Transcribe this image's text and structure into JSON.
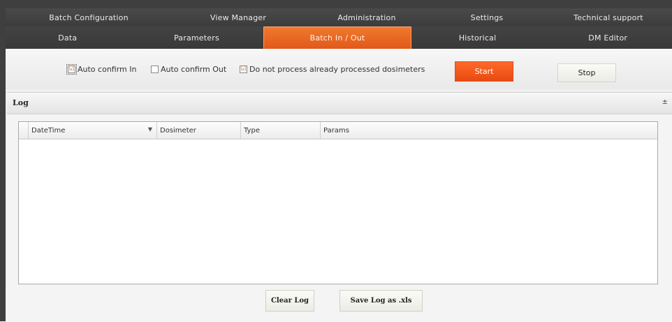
{
  "nav": {
    "top_tabs": [
      {
        "label": "Batch Configuration"
      },
      {
        "label": "View Manager"
      },
      {
        "label": "Administration"
      },
      {
        "label": "Settings"
      },
      {
        "label": "Technical support"
      }
    ],
    "bottom_tabs": [
      {
        "label": "Data"
      },
      {
        "label": "Parameters"
      },
      {
        "label": "Batch In / Out",
        "active": true
      },
      {
        "label": "Historical"
      },
      {
        "label": "DM Editor"
      }
    ]
  },
  "options": {
    "auto_confirm_in": {
      "label": "Auto confirm In",
      "checked": true
    },
    "auto_confirm_out": {
      "label": "Auto confirm Out",
      "checked": false
    },
    "do_not_process": {
      "label": "Do not process already processed dosimeters",
      "checked": true
    },
    "start_label": "Start",
    "stop_label": "Stop"
  },
  "log": {
    "title": "Log",
    "collapse_glyph": "±",
    "columns": [
      "DateTime",
      "Dosimeter",
      "Type",
      "Params"
    ],
    "sort_glyph": "▼",
    "rows": []
  },
  "actions": {
    "clear_label": "Clear Log",
    "save_label": "Save Log as .xls"
  },
  "colors": {
    "accent": "#e8581a",
    "frame": "#3f3f3f"
  },
  "icons": {
    "checkbox_checked": "☑",
    "sort_arrow": "▼",
    "collapse": "±"
  }
}
